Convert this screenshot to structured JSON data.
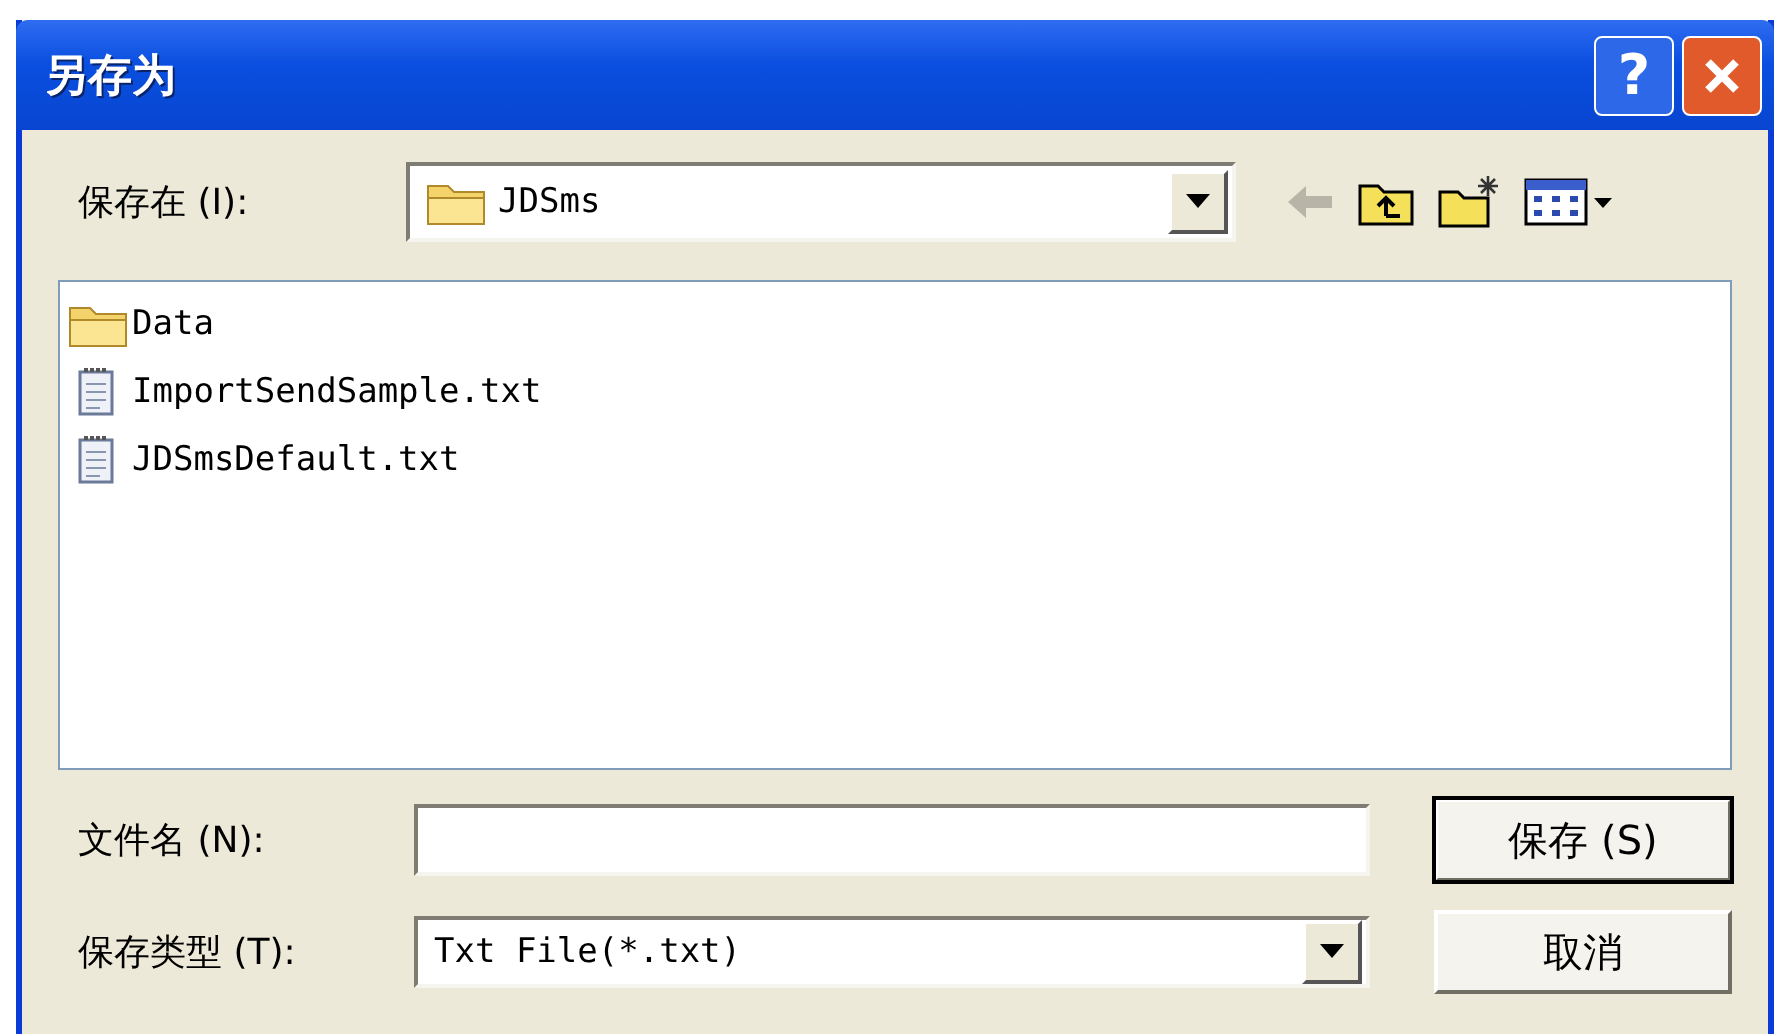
{
  "window": {
    "title": "另存为",
    "help_button": "?"
  },
  "save_in": {
    "label": "保存在 (I):",
    "value": "JDSms"
  },
  "files": [
    {
      "name": "Data",
      "kind": "folder"
    },
    {
      "name": "ImportSendSample.txt",
      "kind": "text"
    },
    {
      "name": "JDSmsDefault.txt",
      "kind": "text"
    }
  ],
  "file_name": {
    "label": "文件名 (N):"
  },
  "save_type": {
    "label": "保存类型 (T):",
    "value": "Txt File(*.txt)"
  },
  "buttons": [
    {
      "label": "保存 (S)",
      "default": true
    },
    {
      "label": "取消",
      "default": false
    }
  ]
}
